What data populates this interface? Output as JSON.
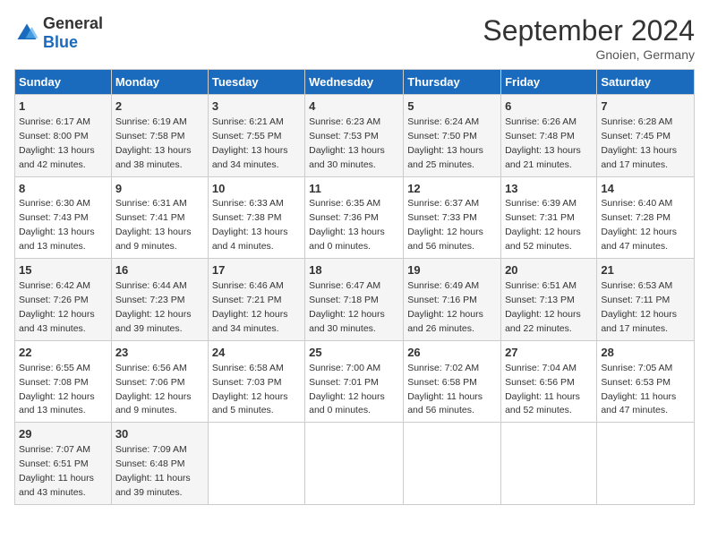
{
  "header": {
    "logo_general": "General",
    "logo_blue": "Blue",
    "month_title": "September 2024",
    "location": "Gnoien, Germany"
  },
  "columns": [
    "Sunday",
    "Monday",
    "Tuesday",
    "Wednesday",
    "Thursday",
    "Friday",
    "Saturday"
  ],
  "weeks": [
    [
      {
        "day": "1",
        "sunrise": "6:17 AM",
        "sunset": "8:00 PM",
        "daylight": "13 hours and 42 minutes."
      },
      {
        "day": "2",
        "sunrise": "6:19 AM",
        "sunset": "7:58 PM",
        "daylight": "13 hours and 38 minutes."
      },
      {
        "day": "3",
        "sunrise": "6:21 AM",
        "sunset": "7:55 PM",
        "daylight": "13 hours and 34 minutes."
      },
      {
        "day": "4",
        "sunrise": "6:23 AM",
        "sunset": "7:53 PM",
        "daylight": "13 hours and 30 minutes."
      },
      {
        "day": "5",
        "sunrise": "6:24 AM",
        "sunset": "7:50 PM",
        "daylight": "13 hours and 25 minutes."
      },
      {
        "day": "6",
        "sunrise": "6:26 AM",
        "sunset": "7:48 PM",
        "daylight": "13 hours and 21 minutes."
      },
      {
        "day": "7",
        "sunrise": "6:28 AM",
        "sunset": "7:45 PM",
        "daylight": "13 hours and 17 minutes."
      }
    ],
    [
      {
        "day": "8",
        "sunrise": "6:30 AM",
        "sunset": "7:43 PM",
        "daylight": "13 hours and 13 minutes."
      },
      {
        "day": "9",
        "sunrise": "6:31 AM",
        "sunset": "7:41 PM",
        "daylight": "13 hours and 9 minutes."
      },
      {
        "day": "10",
        "sunrise": "6:33 AM",
        "sunset": "7:38 PM",
        "daylight": "13 hours and 4 minutes."
      },
      {
        "day": "11",
        "sunrise": "6:35 AM",
        "sunset": "7:36 PM",
        "daylight": "13 hours and 0 minutes."
      },
      {
        "day": "12",
        "sunrise": "6:37 AM",
        "sunset": "7:33 PM",
        "daylight": "12 hours and 56 minutes."
      },
      {
        "day": "13",
        "sunrise": "6:39 AM",
        "sunset": "7:31 PM",
        "daylight": "12 hours and 52 minutes."
      },
      {
        "day": "14",
        "sunrise": "6:40 AM",
        "sunset": "7:28 PM",
        "daylight": "12 hours and 47 minutes."
      }
    ],
    [
      {
        "day": "15",
        "sunrise": "6:42 AM",
        "sunset": "7:26 PM",
        "daylight": "12 hours and 43 minutes."
      },
      {
        "day": "16",
        "sunrise": "6:44 AM",
        "sunset": "7:23 PM",
        "daylight": "12 hours and 39 minutes."
      },
      {
        "day": "17",
        "sunrise": "6:46 AM",
        "sunset": "7:21 PM",
        "daylight": "12 hours and 34 minutes."
      },
      {
        "day": "18",
        "sunrise": "6:47 AM",
        "sunset": "7:18 PM",
        "daylight": "12 hours and 30 minutes."
      },
      {
        "day": "19",
        "sunrise": "6:49 AM",
        "sunset": "7:16 PM",
        "daylight": "12 hours and 26 minutes."
      },
      {
        "day": "20",
        "sunrise": "6:51 AM",
        "sunset": "7:13 PM",
        "daylight": "12 hours and 22 minutes."
      },
      {
        "day": "21",
        "sunrise": "6:53 AM",
        "sunset": "7:11 PM",
        "daylight": "12 hours and 17 minutes."
      }
    ],
    [
      {
        "day": "22",
        "sunrise": "6:55 AM",
        "sunset": "7:08 PM",
        "daylight": "12 hours and 13 minutes."
      },
      {
        "day": "23",
        "sunrise": "6:56 AM",
        "sunset": "7:06 PM",
        "daylight": "12 hours and 9 minutes."
      },
      {
        "day": "24",
        "sunrise": "6:58 AM",
        "sunset": "7:03 PM",
        "daylight": "12 hours and 5 minutes."
      },
      {
        "day": "25",
        "sunrise": "7:00 AM",
        "sunset": "7:01 PM",
        "daylight": "12 hours and 0 minutes."
      },
      {
        "day": "26",
        "sunrise": "7:02 AM",
        "sunset": "6:58 PM",
        "daylight": "11 hours and 56 minutes."
      },
      {
        "day": "27",
        "sunrise": "7:04 AM",
        "sunset": "6:56 PM",
        "daylight": "11 hours and 52 minutes."
      },
      {
        "day": "28",
        "sunrise": "7:05 AM",
        "sunset": "6:53 PM",
        "daylight": "11 hours and 47 minutes."
      }
    ],
    [
      {
        "day": "29",
        "sunrise": "7:07 AM",
        "sunset": "6:51 PM",
        "daylight": "11 hours and 43 minutes."
      },
      {
        "day": "30",
        "sunrise": "7:09 AM",
        "sunset": "6:48 PM",
        "daylight": "11 hours and 39 minutes."
      },
      {
        "day": "",
        "sunrise": "",
        "sunset": "",
        "daylight": ""
      },
      {
        "day": "",
        "sunrise": "",
        "sunset": "",
        "daylight": ""
      },
      {
        "day": "",
        "sunrise": "",
        "sunset": "",
        "daylight": ""
      },
      {
        "day": "",
        "sunrise": "",
        "sunset": "",
        "daylight": ""
      },
      {
        "day": "",
        "sunrise": "",
        "sunset": "",
        "daylight": ""
      }
    ]
  ]
}
